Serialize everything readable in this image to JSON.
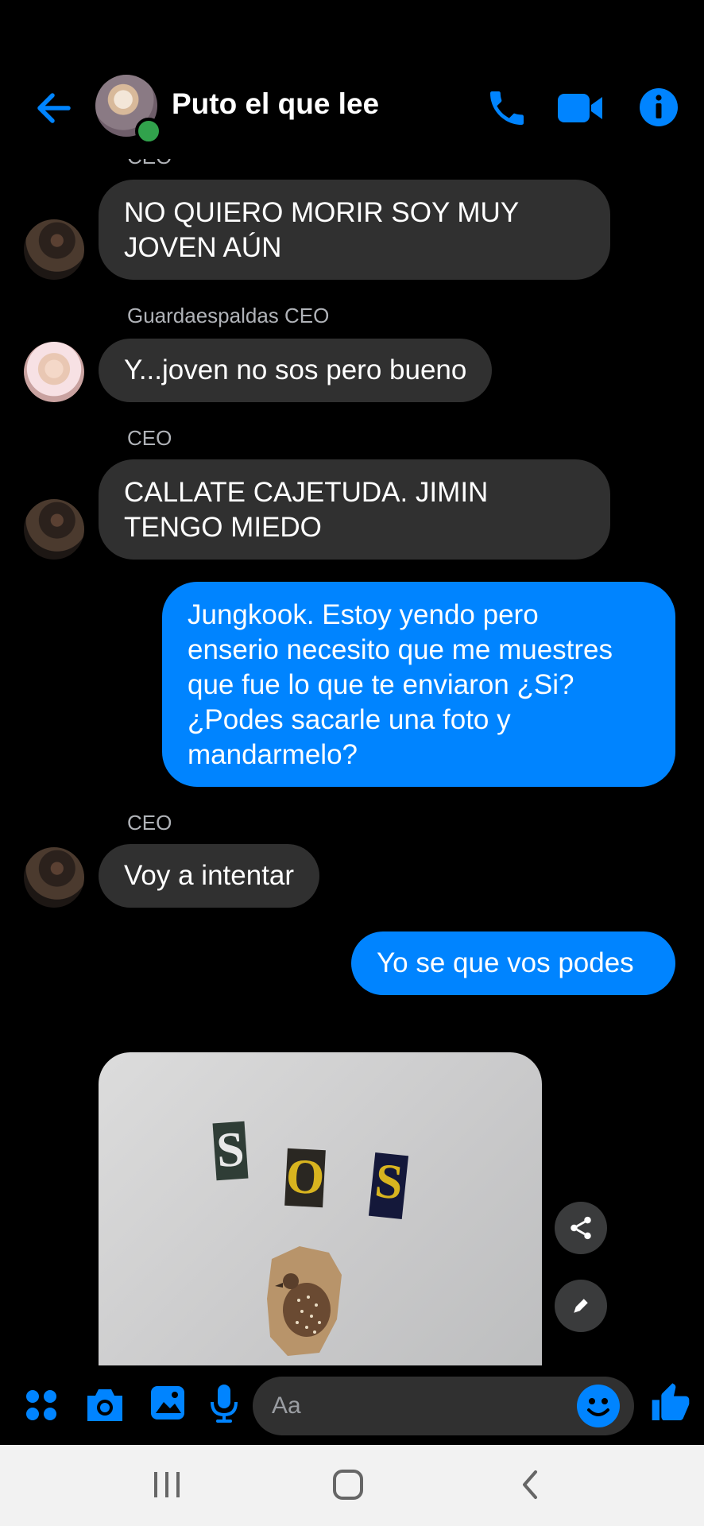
{
  "header": {
    "title": "Puto el que lee"
  },
  "messages": [
    {
      "sender": "CEO",
      "text_lines": [
        "NO QUIERO MORIR SOY MUY",
        "JOVEN AÚN"
      ]
    },
    {
      "sender": "Guardaespaldas CEO",
      "text": "Y...joven no sos pero bueno"
    },
    {
      "sender": "CEO",
      "text_lines": [
        "CALLATE CAJETUDA. JIMIN",
        "TENGO MIEDO"
      ]
    },
    {
      "sender": "",
      "text_lines": [
        "Jungkook. Estoy yendo pero",
        "enserio necesito que me muestres",
        "que fue lo que te enviaron ¿Si?",
        "¿Podes sacarle una foto y",
        "mandarmelo?"
      ]
    },
    {
      "sender": "CEO",
      "text": "Voy a intentar"
    },
    {
      "sender": "",
      "text": "Yo se que vos podes"
    }
  ],
  "photo": {
    "letters": [
      "S",
      "O",
      "S"
    ]
  },
  "composer": {
    "placeholder": "Aa"
  },
  "colors": {
    "accent": "#0084ff",
    "incoming_bubble": "#303030",
    "online": "#31a24c"
  }
}
